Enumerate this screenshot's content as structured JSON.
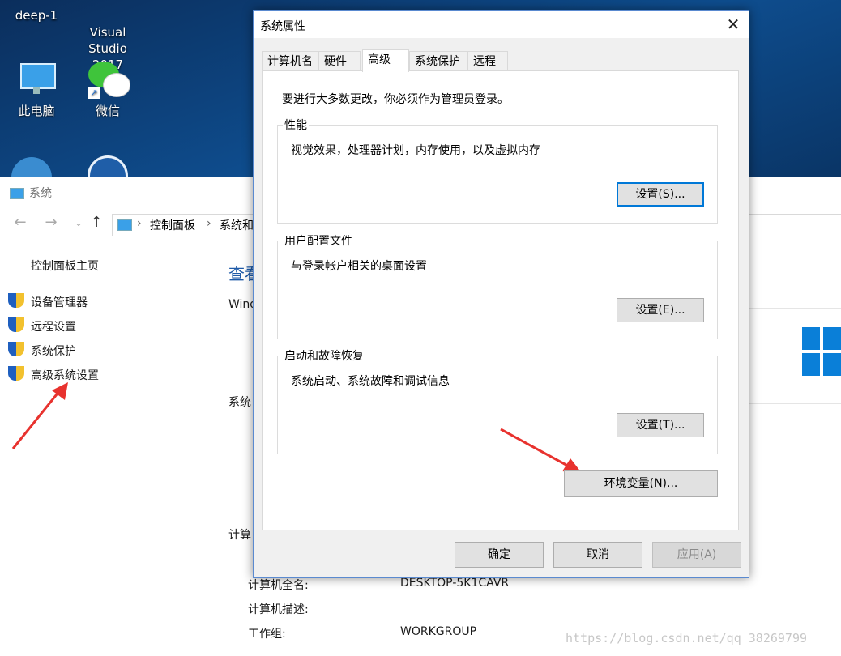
{
  "desktop": {
    "icons": [
      {
        "label": "deep-1"
      },
      {
        "label": "Visual\nStudio 2017"
      },
      {
        "label": "此电脑"
      },
      {
        "label": "微信"
      }
    ]
  },
  "control_panel": {
    "title": "系统",
    "breadcrumb": [
      "控制面板",
      "系统和"
    ],
    "home_link": "控制面板主页",
    "side_links": [
      "设备管理器",
      "远程设置",
      "系统保护",
      "高级系统设置"
    ],
    "main_heading_partial": "查看",
    "labels_partial": {
      "windows_edition": "Wind",
      "system": "系统",
      "computer": "计算"
    },
    "computer_info": [
      {
        "label": "计算机全名:",
        "value": "DESKTOP-5K1CAVR"
      },
      {
        "label": "计算机描述:",
        "value": ""
      },
      {
        "label": "工作组:",
        "value": "WORKGROUP"
      }
    ]
  },
  "dialog": {
    "title": "系统属性",
    "tabs": [
      "计算机名",
      "硬件",
      "高级",
      "系统保护",
      "远程"
    ],
    "active_tab": "高级",
    "admin_note": "要进行大多数更改，你必须作为管理员登录。",
    "groups": [
      {
        "title": "性能",
        "desc": "视觉效果，处理器计划，内存使用，以及虚拟内存",
        "button": "设置(S)..."
      },
      {
        "title": "用户配置文件",
        "desc": "与登录帐户相关的桌面设置",
        "button": "设置(E)..."
      },
      {
        "title": "启动和故障恢复",
        "desc": "系统启动、系统故障和调试信息",
        "button": "设置(T)..."
      }
    ],
    "env_button": "环境变量(N)...",
    "ok_button": "确定",
    "cancel_button": "取消",
    "apply_button": "应用(A)"
  },
  "watermark": "https://blog.csdn.net/qq_38269799",
  "colors": {
    "accent": "#0078d7",
    "link_blue": "#1e5aa8",
    "arrow_red": "#e8322e",
    "desktop_bg": "#0e4d8e"
  }
}
